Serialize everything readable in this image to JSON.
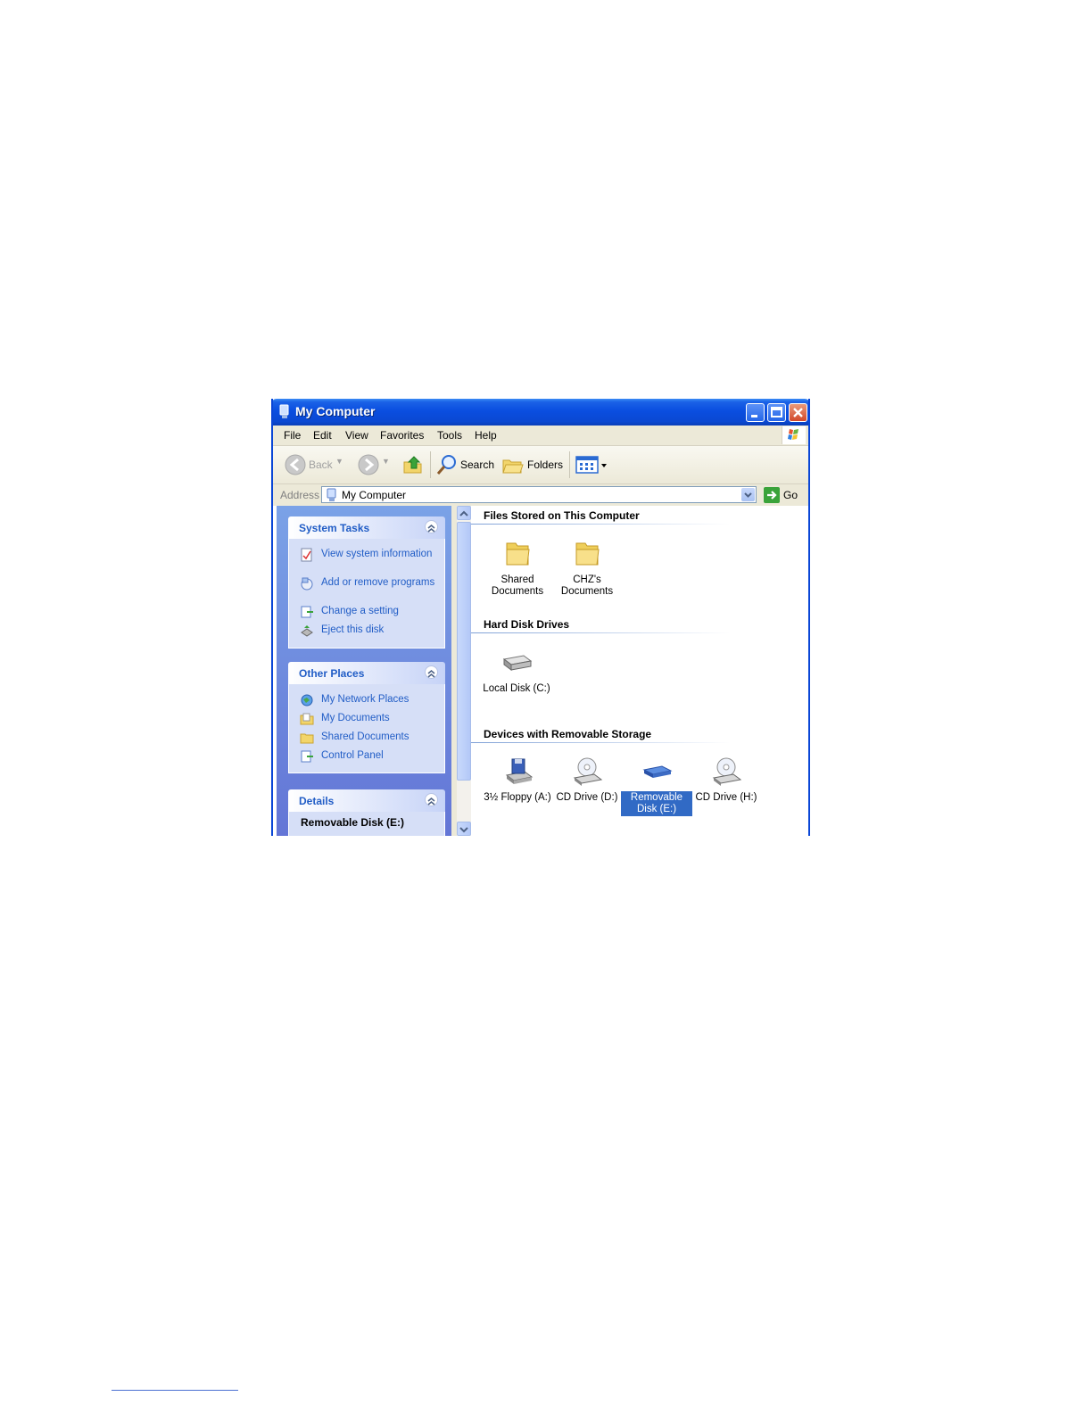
{
  "window": {
    "title": "My Computer",
    "buttons": {
      "minimize": "minimize",
      "maximize": "maximize",
      "close": "close"
    }
  },
  "menu": [
    "File",
    "Edit",
    "View",
    "Favorites",
    "Tools",
    "Help"
  ],
  "toolbar": {
    "back_label": "Back",
    "search_label": "Search",
    "folders_label": "Folders"
  },
  "address": {
    "label": "Address",
    "value": "My Computer",
    "go_label": "Go"
  },
  "panels": {
    "system_tasks": {
      "title": "System Tasks",
      "items": [
        {
          "label": "View system information",
          "icon": "system-info-icon"
        },
        {
          "label": "Add or remove programs",
          "icon": "add-remove-icon"
        },
        {
          "label": "Change a setting",
          "icon": "control-panel-icon"
        },
        {
          "label": "Eject this disk",
          "icon": "eject-icon"
        }
      ]
    },
    "other_places": {
      "title": "Other Places",
      "items": [
        {
          "label": "My Network Places",
          "icon": "network-icon"
        },
        {
          "label": "My Documents",
          "icon": "documents-folder-icon"
        },
        {
          "label": "Shared Documents",
          "icon": "folder-icon"
        },
        {
          "label": "Control Panel",
          "icon": "control-panel-icon"
        }
      ]
    },
    "details": {
      "title": "Details",
      "selected_name": "Removable Disk (E:)"
    }
  },
  "groups": {
    "files": {
      "title": "Files Stored on This Computer",
      "items": [
        {
          "label": "Shared Documents",
          "icon": "folder-icon"
        },
        {
          "label": "CHZ's Documents",
          "icon": "folder-icon"
        }
      ]
    },
    "hard_disks": {
      "title": "Hard Disk Drives",
      "items": [
        {
          "label": "Local Disk (C:)",
          "icon": "hard-disk-icon"
        }
      ]
    },
    "removable": {
      "title": "Devices with Removable Storage",
      "items": [
        {
          "label": "3½ Floppy (A:)",
          "icon": "floppy-drive-icon"
        },
        {
          "label": "CD Drive (D:)",
          "icon": "cd-drive-icon"
        },
        {
          "label": "Removable Disk (E:)",
          "icon": "removable-disk-icon",
          "selected": true
        },
        {
          "label": "CD Drive (H:)",
          "icon": "cd-drive-icon"
        }
      ]
    }
  },
  "colors": {
    "titlebar": "#0a4ee0",
    "task_link": "#215dc6",
    "selection": "#316ac5",
    "left_pane": "#7ba2e7"
  }
}
